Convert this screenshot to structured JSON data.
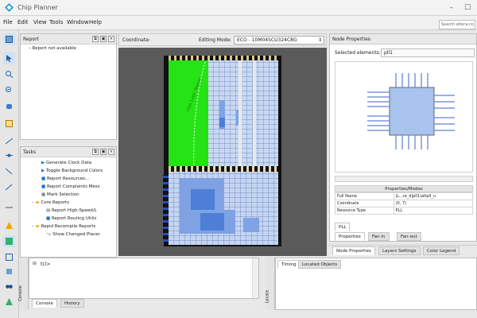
{
  "app": {
    "title": "Chip Planner",
    "window_buttons": [
      "–",
      "☐"
    ]
  },
  "menu": [
    "File",
    "Edit",
    "View",
    "Tools",
    "Window",
    "Help"
  ],
  "search": {
    "placeholder": "Search altera.co"
  },
  "report_panel": {
    "title": "Report",
    "items": [
      "Report not available"
    ]
  },
  "tasks_panel": {
    "title": "Tasks",
    "items": [
      "Generate Clock Data",
      "Toggle Background Colors",
      "Report Resources...",
      "Report Complaints Mess",
      "Mark Selection",
      "Core Reports",
      "Report High-Speed/L",
      "Report Routing Utiliz",
      "Rapid Recompile Reports",
      "Show Changed Placer"
    ]
  },
  "floorplan": {
    "coordinates_label": "Coordinate:",
    "editing_mode_label": "Editing Mode:",
    "editing_mode_value": "ECO - 10M04SCU324C8G",
    "region_label": "User Logic Region"
  },
  "node_properties": {
    "title": "Node Properties",
    "selected_label": "Selected elements:",
    "selected_value": "pll1",
    "table_title": "Properties/Modes",
    "rows": [
      [
        "Full Name",
        "|L...re_d|pll1|altpll_u"
      ],
      [
        "Coordinate",
        "(0, 7)"
      ],
      [
        "Resource Type",
        "PLL"
      ]
    ],
    "chip_tab": "PLL",
    "tabs": [
      "Properties",
      "Fan-in",
      "Fan-out"
    ]
  },
  "bottom_tabs": [
    "Node Properties",
    "Layers Settings",
    "Color Legend"
  ],
  "console": {
    "prompt": "tcl>",
    "tabs": [
      "Console",
      "History"
    ],
    "side_label": "Console"
  },
  "timing_panel": {
    "tabs": [
      "Timing",
      "Located Objects"
    ],
    "side_label": "Locate"
  }
}
